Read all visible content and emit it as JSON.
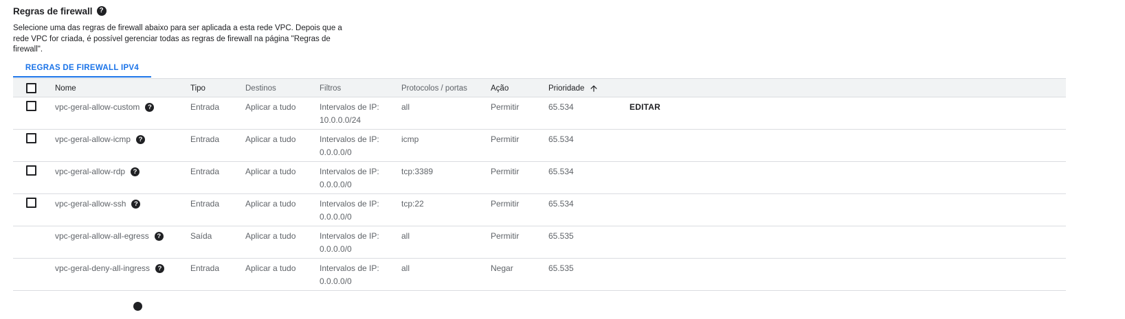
{
  "section": {
    "title": "Regras de firewall",
    "help_icon": "help-icon",
    "description": "Selecione uma das regras de firewall abaixo para ser aplicada a esta rede VPC. Depois que a rede VPC for criada, é possível gerenciar todas as regras de firewall na página \"Regras de firewall\"."
  },
  "tabs": [
    {
      "label": "REGRAS DE FIREWALL IPV4",
      "active": true
    }
  ],
  "table": {
    "headers": {
      "nome": "Nome",
      "tipo": "Tipo",
      "destinos": "Destinos",
      "filtros": "Filtros",
      "protocolos": "Protocolos / portas",
      "acao": "Ação",
      "prioridade": "Prioridade",
      "sort_icon": "arrow-upward-icon"
    },
    "rows": [
      {
        "has_checkbox": true,
        "nome": "vpc-geral-allow-custom",
        "tipo": "Entrada",
        "destinos": "Aplicar a tudo",
        "filtro_label": "Intervalos de IP:",
        "filtro_value": "10.0.0.0/24",
        "protocolos": "all",
        "acao": "Permitir",
        "prioridade": "65.534",
        "edit_label": "EDITAR"
      },
      {
        "has_checkbox": true,
        "nome": "vpc-geral-allow-icmp",
        "tipo": "Entrada",
        "destinos": "Aplicar a tudo",
        "filtro_label": "Intervalos de IP:",
        "filtro_value": "0.0.0.0/0",
        "protocolos": "icmp",
        "acao": "Permitir",
        "prioridade": "65.534"
      },
      {
        "has_checkbox": true,
        "nome": "vpc-geral-allow-rdp",
        "tipo": "Entrada",
        "destinos": "Aplicar a tudo",
        "filtro_label": "Intervalos de IP:",
        "filtro_value": "0.0.0.0/0",
        "protocolos": "tcp:3389",
        "acao": "Permitir",
        "prioridade": "65.534"
      },
      {
        "has_checkbox": true,
        "nome": "vpc-geral-allow-ssh",
        "tipo": "Entrada",
        "destinos": "Aplicar a tudo",
        "filtro_label": "Intervalos de IP:",
        "filtro_value": "0.0.0.0/0",
        "protocolos": "tcp:22",
        "acao": "Permitir",
        "prioridade": "65.534"
      },
      {
        "has_checkbox": false,
        "nome": "vpc-geral-allow-all-egress",
        "tipo": "Saída",
        "destinos": "Aplicar a tudo",
        "filtro_label": "Intervalos de IP:",
        "filtro_value": "0.0.0.0/0",
        "protocolos": "all",
        "acao": "Permitir",
        "prioridade": "65.535"
      },
      {
        "has_checkbox": false,
        "nome": "vpc-geral-deny-all-ingress",
        "tipo": "Entrada",
        "destinos": "Aplicar a tudo",
        "filtro_label": "Intervalos de IP:",
        "filtro_value": "0.0.0.0/0",
        "protocolos": "all",
        "acao": "Negar",
        "prioridade": "65.535"
      }
    ]
  }
}
